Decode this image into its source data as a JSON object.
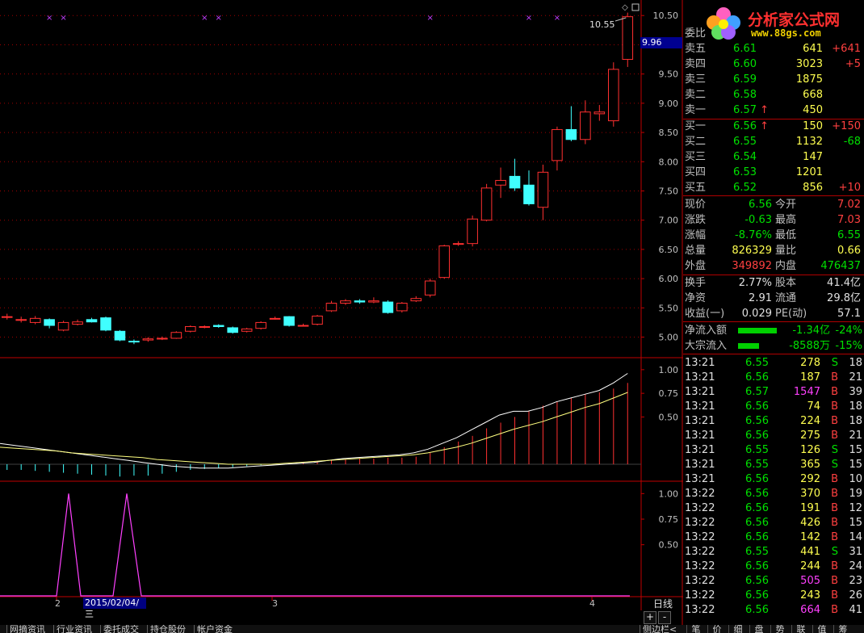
{
  "chart_data": [
    {
      "type": "candlestick",
      "title": "",
      "price_ticks": [
        "10.50",
        "10.00",
        "9.50",
        "9.00",
        "8.50",
        "8.00",
        "7.50",
        "7.00",
        "6.50",
        "6.00",
        "5.50",
        "5.00"
      ],
      "ylim": [
        4.8,
        10.6
      ],
      "highlight_price": "9.96",
      "high_marker": "10.55",
      "colors": {
        "up": "#ff3030",
        "down": "#40ffff",
        "grid": "#a00000"
      },
      "candles": [
        {
          "o": 5.35,
          "c": 5.35,
          "h": 5.4,
          "l": 5.3
        },
        {
          "o": 5.3,
          "c": 5.3,
          "h": 5.35,
          "l": 5.25
        },
        {
          "o": 5.25,
          "c": 5.32,
          "h": 5.36,
          "l": 5.22
        },
        {
          "o": 5.3,
          "c": 5.2,
          "h": 5.32,
          "l": 5.15
        },
        {
          "o": 5.12,
          "c": 5.25,
          "h": 5.28,
          "l": 5.1
        },
        {
          "o": 5.22,
          "c": 5.26,
          "h": 5.3,
          "l": 5.2
        },
        {
          "o": 5.3,
          "c": 5.26,
          "h": 5.33,
          "l": 5.25
        },
        {
          "o": 5.33,
          "c": 5.12,
          "h": 5.35,
          "l": 5.1
        },
        {
          "o": 5.1,
          "c": 4.95,
          "h": 5.12,
          "l": 4.93
        },
        {
          "o": 4.93,
          "c": 4.92,
          "h": 4.96,
          "l": 4.88
        },
        {
          "o": 4.95,
          "c": 4.97,
          "h": 5.0,
          "l": 4.92
        },
        {
          "o": 4.98,
          "c": 4.98,
          "h": 5.01,
          "l": 4.95
        },
        {
          "o": 4.98,
          "c": 5.08,
          "h": 5.1,
          "l": 4.97
        },
        {
          "o": 5.1,
          "c": 5.18,
          "h": 5.2,
          "l": 5.08
        },
        {
          "o": 5.18,
          "c": 5.18,
          "h": 5.2,
          "l": 5.15
        },
        {
          "o": 5.2,
          "c": 5.18,
          "h": 5.22,
          "l": 5.16
        },
        {
          "o": 5.16,
          "c": 5.08,
          "h": 5.18,
          "l": 5.06
        },
        {
          "o": 5.1,
          "c": 5.14,
          "h": 5.16,
          "l": 5.08
        },
        {
          "o": 5.15,
          "c": 5.25,
          "h": 5.27,
          "l": 5.13
        },
        {
          "o": 5.32,
          "c": 5.32,
          "h": 5.35,
          "l": 5.3
        },
        {
          "o": 5.35,
          "c": 5.2,
          "h": 5.36,
          "l": 5.18
        },
        {
          "o": 5.2,
          "c": 5.2,
          "h": 5.23,
          "l": 5.18
        },
        {
          "o": 5.22,
          "c": 5.36,
          "h": 5.38,
          "l": 5.2
        },
        {
          "o": 5.45,
          "c": 5.58,
          "h": 5.62,
          "l": 5.43
        },
        {
          "o": 5.58,
          "c": 5.62,
          "h": 5.65,
          "l": 5.55
        },
        {
          "o": 5.62,
          "c": 5.6,
          "h": 5.65,
          "l": 5.57
        },
        {
          "o": 5.6,
          "c": 5.62,
          "h": 5.68,
          "l": 5.58
        },
        {
          "o": 5.6,
          "c": 5.42,
          "h": 5.63,
          "l": 5.4
        },
        {
          "o": 5.45,
          "c": 5.58,
          "h": 5.6,
          "l": 5.42
        },
        {
          "o": 5.62,
          "c": 5.66,
          "h": 5.7,
          "l": 5.6
        },
        {
          "o": 5.72,
          "c": 5.96,
          "h": 6.0,
          "l": 5.68
        },
        {
          "o": 6.02,
          "c": 6.56,
          "h": 6.58,
          "l": 6.0
        },
        {
          "o": 6.6,
          "c": 6.6,
          "h": 6.64,
          "l": 6.56
        },
        {
          "o": 6.6,
          "c": 7.02,
          "h": 7.08,
          "l": 6.55
        },
        {
          "o": 7.0,
          "c": 7.55,
          "h": 7.62,
          "l": 6.98
        },
        {
          "o": 7.6,
          "c": 7.68,
          "h": 7.9,
          "l": 7.38
        },
        {
          "o": 7.75,
          "c": 7.55,
          "h": 8.05,
          "l": 7.5
        },
        {
          "o": 7.6,
          "c": 7.28,
          "h": 7.85,
          "l": 7.25
        },
        {
          "o": 7.22,
          "c": 7.82,
          "h": 7.95,
          "l": 7.0
        },
        {
          "o": 8.02,
          "c": 8.55,
          "h": 8.6,
          "l": 7.85
        },
        {
          "o": 8.55,
          "c": 8.38,
          "h": 8.95,
          "l": 8.35
        },
        {
          "o": 8.38,
          "c": 8.85,
          "h": 9.05,
          "l": 8.3
        },
        {
          "o": 8.82,
          "c": 8.85,
          "h": 8.97,
          "l": 8.7
        },
        {
          "o": 8.7,
          "c": 9.58,
          "h": 9.7,
          "l": 8.6
        },
        {
          "o": 9.75,
          "c": 10.48,
          "h": 10.55,
          "l": 9.62
        }
      ],
      "top_markers_idx": [
        3,
        4,
        14,
        15,
        30,
        37,
        39
      ]
    },
    {
      "type": "line",
      "title": "",
      "y_ticks": [
        "1.00",
        "0.75",
        "0.50"
      ],
      "ylim": [
        0,
        1.05
      ],
      "series": [
        {
          "values": [
            0.22,
            0.2,
            0.18,
            0.16,
            0.14,
            0.12,
            0.1,
            0.08,
            0.06,
            0.04,
            0.02,
            0.0,
            -0.02,
            -0.03,
            -0.04,
            -0.04,
            -0.04,
            -0.03,
            -0.02,
            -0.01,
            0.0,
            0.01,
            0.02,
            0.04,
            0.06,
            0.07,
            0.08,
            0.09,
            0.1,
            0.12,
            0.16,
            0.22,
            0.28,
            0.36,
            0.44,
            0.52,
            0.56,
            0.56,
            0.6,
            0.66,
            0.7,
            0.74,
            0.78,
            0.86,
            0.96
          ],
          "color": "#ffffff"
        },
        {
          "values": [
            0.18,
            0.17,
            0.16,
            0.15,
            0.14,
            0.12,
            0.11,
            0.1,
            0.09,
            0.08,
            0.07,
            0.05,
            0.04,
            0.03,
            0.02,
            0.01,
            0.0,
            0.0,
            0.0,
            0.0,
            0.01,
            0.02,
            0.03,
            0.04,
            0.05,
            0.06,
            0.07,
            0.08,
            0.09,
            0.1,
            0.12,
            0.15,
            0.18,
            0.22,
            0.27,
            0.32,
            0.37,
            0.41,
            0.45,
            0.5,
            0.55,
            0.6,
            0.64,
            0.7,
            0.76
          ],
          "color": "#ffff80"
        }
      ],
      "bars": [
        -0.06,
        -0.06,
        -0.07,
        -0.08,
        -0.09,
        -0.1,
        -0.11,
        -0.12,
        -0.13,
        -0.12,
        -0.12,
        -0.1,
        -0.08,
        -0.06,
        -0.05,
        -0.04,
        -0.03,
        -0.02,
        -0.01,
        0.0,
        0.01,
        0.02,
        0.03,
        0.04,
        0.05,
        0.06,
        0.06,
        0.07,
        0.07,
        0.08,
        0.12,
        0.18,
        0.24,
        0.3,
        0.38,
        0.44,
        0.5,
        0.56,
        0.62,
        0.66,
        0.7,
        0.74,
        0.76,
        0.8,
        0.86
      ]
    },
    {
      "type": "line",
      "title": "",
      "y_ticks": [
        "1.00",
        "0.75",
        "0.50"
      ],
      "ylim": [
        0,
        1.05
      ],
      "series": [
        {
          "x": [
            0,
            70,
            85,
            100,
            140,
            157,
            175,
            780
          ],
          "values": [
            0,
            0,
            1,
            0,
            0,
            1,
            0,
            0
          ],
          "color": "#ff40ff"
        }
      ]
    }
  ],
  "x_axis": {
    "labels": [
      "2",
      "3",
      "4"
    ],
    "cursor_date": "2015/02/04/三",
    "period": "日线",
    "zoom_in": "+",
    "zoom_out": "-"
  },
  "logo": {
    "title": "分析家公式网",
    "url": "www.88gs.com"
  },
  "order_book": {
    "header": "委比",
    "asks": [
      {
        "label": "卖五",
        "price": "6.61",
        "vol": "641",
        "chg": "+641"
      },
      {
        "label": "卖四",
        "price": "6.60",
        "vol": "3023",
        "chg": "+5"
      },
      {
        "label": "卖三",
        "price": "6.59",
        "vol": "1875",
        "chg": ""
      },
      {
        "label": "卖二",
        "price": "6.58",
        "vol": "668",
        "chg": ""
      },
      {
        "label": "卖一",
        "price": "6.57",
        "vol": "450",
        "chg": "",
        "arrow": "↑"
      }
    ],
    "bids": [
      {
        "label": "买一",
        "price": "6.56",
        "vol": "150",
        "chg": "+150",
        "arrow": "↑"
      },
      {
        "label": "买二",
        "price": "6.55",
        "vol": "1132",
        "chg": "-68"
      },
      {
        "label": "买三",
        "price": "6.54",
        "vol": "147",
        "chg": ""
      },
      {
        "label": "买四",
        "price": "6.53",
        "vol": "1201",
        "chg": ""
      },
      {
        "label": "买五",
        "price": "6.52",
        "vol": "856",
        "chg": "+10"
      }
    ]
  },
  "quote": [
    {
      "l1": "现价",
      "v1": "6.56",
      "c1": "g",
      "l2": "今开",
      "v2": "7.02",
      "c2": "r"
    },
    {
      "l1": "涨跌",
      "v1": "-0.63",
      "c1": "g",
      "l2": "最高",
      "v2": "7.03",
      "c2": "r"
    },
    {
      "l1": "涨幅",
      "v1": "-8.76%",
      "c1": "g",
      "l2": "最低",
      "v2": "6.55",
      "c2": "g"
    },
    {
      "l1": "总量",
      "v1": "826329",
      "c1": "y",
      "l2": "量比",
      "v2": "0.66",
      "c2": "y"
    },
    {
      "l1": "外盘",
      "v1": "349892",
      "c1": "r",
      "l2": "内盘",
      "v2": "476437",
      "c2": "g"
    }
  ],
  "fundamentals": [
    {
      "l1": "换手",
      "v1": "2.77%",
      "l2": "股本",
      "v2": "41.4亿"
    },
    {
      "l1": "净资",
      "v1": "2.91",
      "l2": "流通",
      "v2": "29.8亿"
    },
    {
      "l1": "收益(一)",
      "v1": "0.029",
      "l2": "PE(动)",
      "v2": "57.1"
    }
  ],
  "flows": [
    {
      "label": "净流入额",
      "value": "-1.34亿",
      "pct": "-24%",
      "bar": 0.75
    },
    {
      "label": "大宗流入",
      "value": "-8588万",
      "pct": "-15%",
      "bar": 0.4
    }
  ],
  "ticks": [
    {
      "t": "13:21",
      "p": "6.55",
      "pc": "g",
      "v": "278",
      "vc": "y",
      "s": "S",
      "n": "18"
    },
    {
      "t": "13:21",
      "p": "6.56",
      "pc": "g",
      "v": "187",
      "vc": "y",
      "s": "B",
      "n": "21"
    },
    {
      "t": "13:21",
      "p": "6.57",
      "pc": "g",
      "v": "1547",
      "vc": "m",
      "s": "B",
      "n": "39"
    },
    {
      "t": "13:21",
      "p": "6.56",
      "pc": "g",
      "v": "74",
      "vc": "y",
      "s": "B",
      "n": "18"
    },
    {
      "t": "13:21",
      "p": "6.56",
      "pc": "g",
      "v": "224",
      "vc": "y",
      "s": "B",
      "n": "18"
    },
    {
      "t": "13:21",
      "p": "6.56",
      "pc": "g",
      "v": "275",
      "vc": "y",
      "s": "B",
      "n": "21"
    },
    {
      "t": "13:21",
      "p": "6.55",
      "pc": "g",
      "v": "126",
      "vc": "y",
      "s": "S",
      "n": "15"
    },
    {
      "t": "13:21",
      "p": "6.55",
      "pc": "g",
      "v": "365",
      "vc": "y",
      "s": "S",
      "n": "15"
    },
    {
      "t": "13:21",
      "p": "6.56",
      "pc": "g",
      "v": "292",
      "vc": "y",
      "s": "B",
      "n": "10"
    },
    {
      "t": "13:22",
      "p": "6.56",
      "pc": "g",
      "v": "370",
      "vc": "y",
      "s": "B",
      "n": "19"
    },
    {
      "t": "13:22",
      "p": "6.56",
      "pc": "g",
      "v": "191",
      "vc": "y",
      "s": "B",
      "n": "12"
    },
    {
      "t": "13:22",
      "p": "6.56",
      "pc": "g",
      "v": "426",
      "vc": "y",
      "s": "B",
      "n": "15"
    },
    {
      "t": "13:22",
      "p": "6.56",
      "pc": "g",
      "v": "142",
      "vc": "y",
      "s": "B",
      "n": "14"
    },
    {
      "t": "13:22",
      "p": "6.55",
      "pc": "g",
      "v": "441",
      "vc": "y",
      "s": "S",
      "n": "31"
    },
    {
      "t": "13:22",
      "p": "6.56",
      "pc": "g",
      "v": "244",
      "vc": "y",
      "s": "B",
      "n": "24"
    },
    {
      "t": "13:22",
      "p": "6.56",
      "pc": "g",
      "v": "505",
      "vc": "m",
      "s": "B",
      "n": "23"
    },
    {
      "t": "13:22",
      "p": "6.56",
      "pc": "g",
      "v": "243",
      "vc": "y",
      "s": "B",
      "n": "26"
    },
    {
      "t": "13:22",
      "p": "6.56",
      "pc": "g",
      "v": "664",
      "vc": "m",
      "s": "B",
      "n": "41"
    }
  ],
  "bottom_tabs": [
    "网摘资讯",
    "行业资讯",
    "委托成交",
    "持仓股份",
    "帐户资金"
  ],
  "side_tabs": [
    "笔",
    "价",
    "细",
    "盘",
    "势",
    "联",
    "值",
    "筹"
  ],
  "side_tab_extra": "侧边栏<"
}
